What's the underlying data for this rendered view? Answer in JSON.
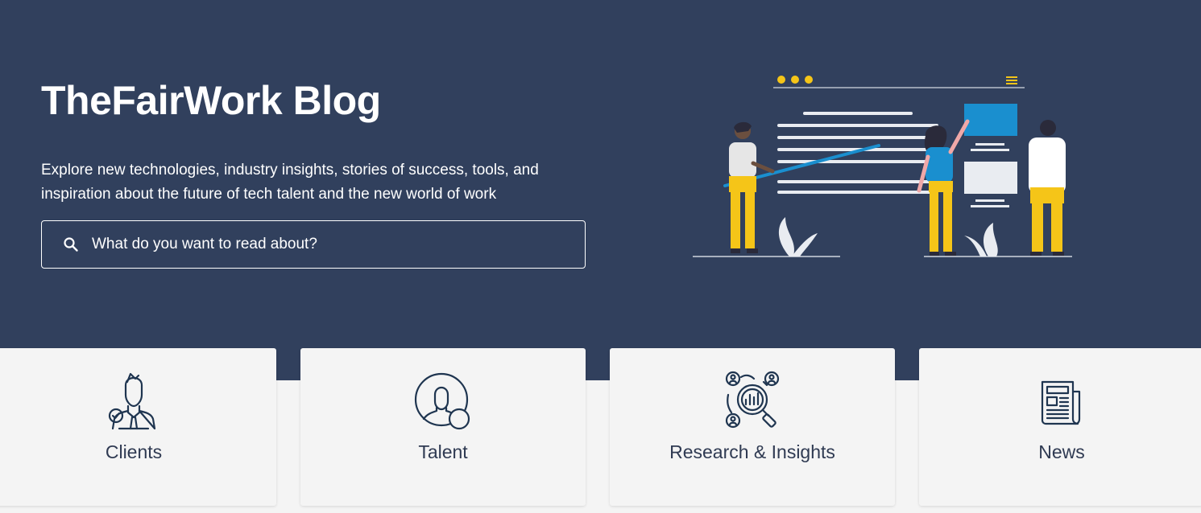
{
  "hero": {
    "title": "TheFairWork Blog",
    "subtitle": "Explore new technologies, industry insights, stories of success, tools, and inspiration about the future of tech talent and the new world of work",
    "search_placeholder": "What do you want to read about?"
  },
  "categories": [
    {
      "label": "Clients",
      "icon": "client-icon"
    },
    {
      "label": "Talent",
      "icon": "talent-icon"
    },
    {
      "label": "Research & Insights",
      "icon": "research-icon"
    },
    {
      "label": "News",
      "icon": "news-icon"
    }
  ],
  "colors": {
    "hero_bg": "#31405d",
    "accent_yellow": "#f5c518",
    "accent_blue": "#1a8fcf",
    "card_bg": "#f4f4f4",
    "text_dark": "#2f3a52"
  }
}
